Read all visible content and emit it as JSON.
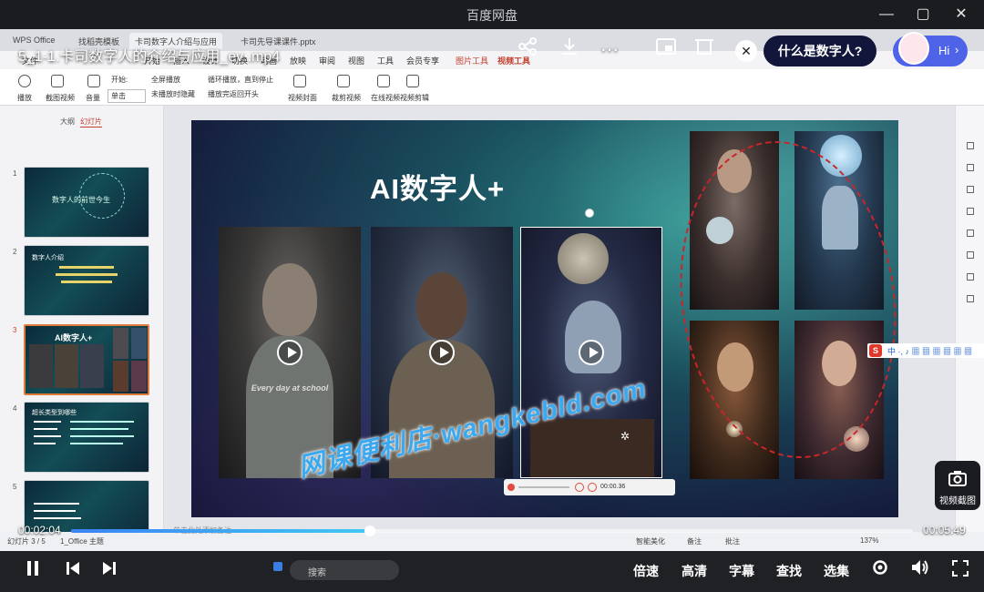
{
  "window": {
    "title": "百度网盘"
  },
  "video": {
    "filename": "5_1-1.卡司数字人的介绍与应用_ev .mp4",
    "question_prompt": "什么是数字人?",
    "assistant_greeting": "Hi",
    "screenshot_label": "视频截图"
  },
  "ppt": {
    "tabs": [
      "WPS Office",
      "找稻壳模板",
      "卡司数字人介绍与应用",
      "卡司先导课课件.pptx"
    ],
    "menu": [
      "文件",
      "开始",
      "插入",
      "设计",
      "切换",
      "动画",
      "放映",
      "审阅",
      "视图",
      "工具",
      "会员专享",
      "图片工具",
      "视频工具"
    ],
    "ribbon": [
      "播放",
      "截图视频",
      "音量",
      "开始:",
      "单击",
      "全屏播放",
      "未播放时隐藏",
      "循环播放，直到停止",
      "播放完返回开头",
      "视频封面",
      "裁剪视频",
      "在线视频",
      "视频剪辑"
    ],
    "panel_tabs": [
      "大纲",
      "幻灯片"
    ],
    "slide_numbers": [
      "1",
      "2",
      "3",
      "4",
      "5"
    ],
    "thumb_titles": [
      "数字人的前世今生",
      "数字人介绍",
      "AI数字人+",
      "超长类型到哪些",
      ""
    ],
    "slide_title": "AI数字人+",
    "video_caption": "Every day at school",
    "mini_player_time": "00:00.36",
    "status_left": "幻灯片 3 / 5",
    "status_theme": "1_Office 主题",
    "notes_hint": "单击此处添加备注",
    "status_right": [
      "智能美化",
      "备注",
      "批注"
    ],
    "zoom": "137%",
    "watermark": "网课便利店·wangkebld.com"
  },
  "taskbar": {
    "search_placeholder": "搜索"
  },
  "player": {
    "current_time": "00:02:04",
    "total_time": "00:05:49",
    "progress": 0.355,
    "speed_label": "倍速",
    "quality_label": "高清",
    "subtitle_label": "字幕",
    "search_label": "查找",
    "episodes_label": "选集"
  },
  "colors": {
    "accent": "#3b83f5",
    "brand_dark": "#12163a",
    "assistant": "#4f63e8",
    "ring": "#c8262a"
  }
}
